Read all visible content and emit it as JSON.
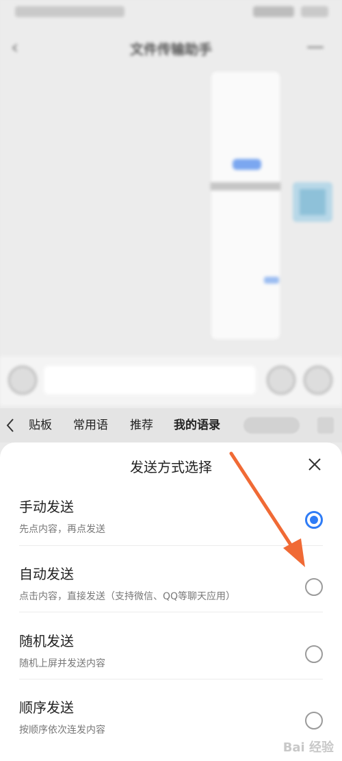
{
  "chat": {
    "title": "文件传输助手"
  },
  "keyboard_toolbar": {
    "tabs": [
      {
        "label": "贴板"
      },
      {
        "label": "常用语"
      },
      {
        "label": "推荐"
      },
      {
        "label": "我的语录",
        "active": true
      }
    ]
  },
  "sheet": {
    "title": "发送方式选择",
    "options": [
      {
        "title": "手动发送",
        "desc": "先点内容，再点发送",
        "selected": true
      },
      {
        "title": "自动发送",
        "desc": "点击内容，直接发送（支持微信、QQ等聊天应用）",
        "selected": false
      },
      {
        "title": "随机发送",
        "desc": "随机上屏并发送内容",
        "selected": false
      },
      {
        "title": "顺序发送",
        "desc": "按顺序依次连发内容",
        "selected": false
      }
    ]
  },
  "watermark": {
    "text": "Bai 经验"
  },
  "colors": {
    "accent": "#2f7cf6",
    "arrow": "#f06a35",
    "sheet_bg": "#ffffff",
    "backdrop": "#eaeaea"
  },
  "icons": {
    "close": "close-icon",
    "back": "chevron-left-icon",
    "radio_selected": "radio-selected-icon",
    "radio_empty": "radio-empty-icon"
  }
}
